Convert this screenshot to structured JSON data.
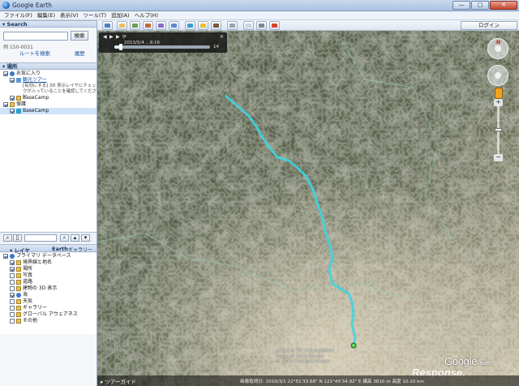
{
  "window": {
    "title": "Google Earth",
    "controls": [
      "—",
      "□",
      "✕"
    ]
  },
  "menu": [
    "ファイル(F)",
    "編集(E)",
    "表示(V)",
    "ツール(T)",
    "追加(A)",
    "ヘルプ(H)"
  ],
  "search": {
    "header": "▾ Search",
    "button": "検索",
    "example": "例 150-0031",
    "route_link": "ルートを検索",
    "history_link": "履歴"
  },
  "places": {
    "header": "▾ 場所",
    "items": [
      {
        "label": "お気に入り",
        "checked": true
      },
      {
        "label": "観光ツアー",
        "checked": true
      },
      {
        "label": "BaseCamp",
        "checked": true
      },
      {
        "label": "保護",
        "checked": true
      },
      {
        "label": "BaseCamp",
        "checked": true,
        "selected": true
      }
    ],
    "tour_note": "[有効にする] 3D 表示レイヤにチェックが入っていることを確認してください"
  },
  "layers": {
    "header": "▾ レイヤ",
    "earth": "Earth",
    "gallery": "ギャラリー »",
    "items": [
      {
        "label": "プライマリ データベース",
        "checked": true
      },
      {
        "label": "境界線と地名",
        "checked": true
      },
      {
        "label": "場所",
        "checked": true
      },
      {
        "label": "写真",
        "checked": false
      },
      {
        "label": "道路",
        "checked": false
      },
      {
        "label": "建物の 3D 表示",
        "checked": false
      },
      {
        "label": "海",
        "checked": true
      },
      {
        "label": "天気",
        "checked": false
      },
      {
        "label": "ギャラリー",
        "checked": false
      },
      {
        "label": "グローバル アウェアネス",
        "checked": false
      },
      {
        "label": "その他",
        "checked": false
      }
    ]
  },
  "toolbar": {
    "login": "ログイン"
  },
  "tour_player": {
    "date": "2013/5/4 ...8:16",
    "progress": 0.07,
    "count": "14"
  },
  "map": {
    "copyright": "Image © 2013 DigitalGlobe\nImage © 2013 GeoEye\n© 2013 Cnes/Spot Image",
    "logo_main": "Google",
    "logo_sub": "earth",
    "watermark": "Response.",
    "tour_guide": "▸ ツアーガイド",
    "status": "画像取得日: 2010/3/1   22°51'33.68\" N 121°45'34.92\" E 標高 3810 m  高度 10.10 km"
  },
  "colors": {
    "route": "#3fd4e0",
    "panel_bg": "#f4f6f9",
    "accent": "#1b4fa0"
  }
}
